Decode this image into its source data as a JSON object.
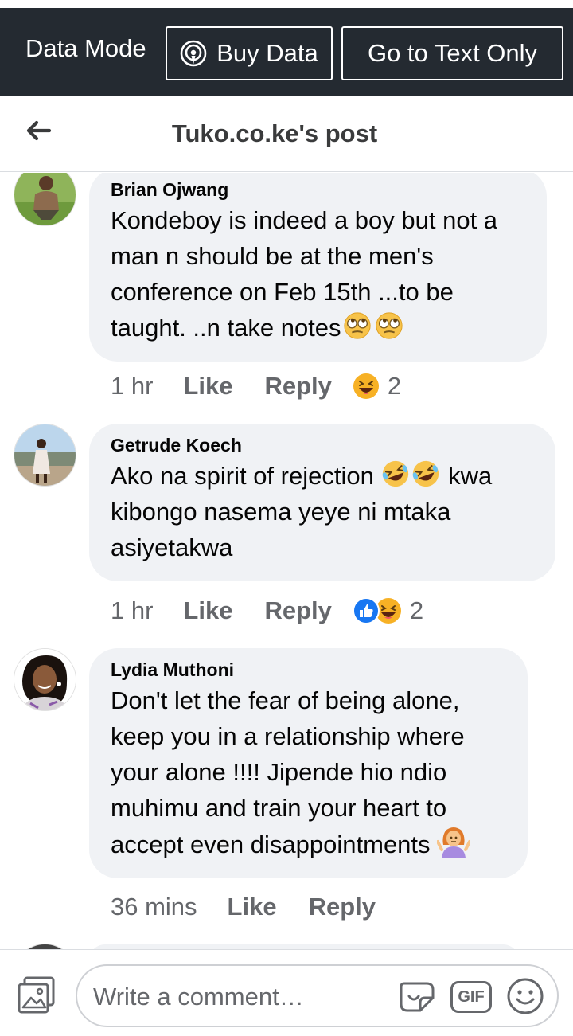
{
  "data_mode": {
    "label": "Data Mode",
    "buy_data": "Buy Data",
    "text_only": "Go to Text Only"
  },
  "header": {
    "title": "Tuko.co.ke's post"
  },
  "comments": [
    {
      "author": "Brian Ojwang",
      "text": "Kondeboy is indeed a boy but not a man n should be at the men's conference on Feb 15th ...to be taught. ..n take notes",
      "time": "1 hr",
      "like": "Like",
      "reply": "Reply",
      "reaction_count": "2",
      "reactions": [
        "laughing-emoji-icon"
      ]
    },
    {
      "author": "Getrude Koech",
      "text_before": "Ako na spirit of rejection",
      "text_after": "kwa kibongo nasema yeye ni mtaka asiyetakwa",
      "time": "1 hr",
      "like": "Like",
      "reply": "Reply",
      "reaction_count": "2",
      "reactions": [
        "thumbs-up-icon",
        "laughing-emoji-icon"
      ]
    },
    {
      "author": "Lydia Muthoni",
      "text": "Don't let the fear of being alone, keep you in a  relationship where your alone !!!! Jipende hio ndio muhimu and train your heart to accept even disappointments",
      "time": "36 mins",
      "like": "Like",
      "reply": "Reply"
    }
  ],
  "composer": {
    "placeholder": "Write a comment…",
    "gif": "GIF"
  },
  "colors": {
    "data_bar": "#242a31",
    "bubble": "#f0f2f5",
    "meta_text": "#65676b",
    "like_blue": "#1877f2",
    "emoji_yellow": "#f7b125"
  }
}
